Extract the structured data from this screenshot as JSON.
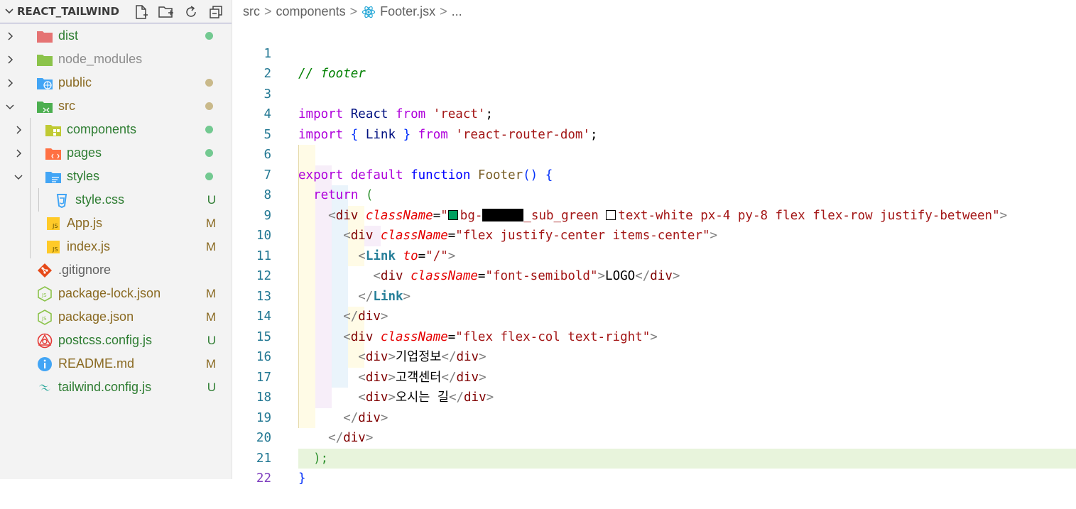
{
  "explorer": {
    "title": "REACT_TAILWIND",
    "actions": [
      "new-file-icon",
      "new-folder-icon",
      "refresh-icon",
      "collapse-all-icon"
    ],
    "items": [
      {
        "label": "dist",
        "type": "folder",
        "expanded": false,
        "depth": 0,
        "color": "#2e7d32",
        "status": "dot",
        "dot_color": "#73c991"
      },
      {
        "label": "node_modules",
        "type": "folder",
        "expanded": false,
        "depth": 0,
        "color": "#8c8c8c",
        "status": "",
        "dot_color": ""
      },
      {
        "label": "public",
        "type": "folder",
        "expanded": false,
        "depth": 0,
        "color": "#8a6a22",
        "status": "dot",
        "dot_color": "#c9b98a"
      },
      {
        "label": "src",
        "type": "folder",
        "expanded": true,
        "depth": 0,
        "color": "#8a6a22",
        "status": "dot",
        "dot_color": "#c9b98a"
      },
      {
        "label": "components",
        "type": "folder",
        "expanded": false,
        "depth": 1,
        "color": "#2e7d32",
        "status": "dot",
        "dot_color": "#73c991"
      },
      {
        "label": "pages",
        "type": "folder",
        "expanded": false,
        "depth": 1,
        "color": "#2e7d32",
        "status": "dot",
        "dot_color": "#73c991"
      },
      {
        "label": "styles",
        "type": "folder",
        "expanded": true,
        "depth": 1,
        "color": "#2e7d32",
        "status": "dot",
        "dot_color": "#73c991"
      },
      {
        "label": "style.css",
        "type": "file",
        "depth": 2,
        "color": "#2e7d32",
        "status": "U"
      },
      {
        "label": "App.js",
        "type": "file",
        "depth": 1,
        "color": "#8a6a22",
        "status": "M"
      },
      {
        "label": "index.js",
        "type": "file",
        "depth": 1,
        "color": "#8a6a22",
        "status": "M"
      },
      {
        "label": ".gitignore",
        "type": "file",
        "depth": 0,
        "color": "#616161",
        "status": ""
      },
      {
        "label": "package-lock.json",
        "type": "file",
        "depth": 0,
        "color": "#8a6a22",
        "status": "M"
      },
      {
        "label": "package.json",
        "type": "file",
        "depth": 0,
        "color": "#8a6a22",
        "status": "M"
      },
      {
        "label": "postcss.config.js",
        "type": "file",
        "depth": 0,
        "color": "#2e7d32",
        "status": "U"
      },
      {
        "label": "README.md",
        "type": "file",
        "depth": 0,
        "color": "#8a6a22",
        "status": "M"
      },
      {
        "label": "tailwind.config.js",
        "type": "file",
        "depth": 0,
        "color": "#2e7d32",
        "status": "U"
      }
    ]
  },
  "breadcrumb": {
    "parts": [
      "src",
      "components",
      "Footer.jsx",
      "..."
    ],
    "separator": ">"
  },
  "editor": {
    "active_line": 22,
    "line_numbers": [
      "1",
      "2",
      "3",
      "4",
      "5",
      "6",
      "7",
      "8",
      "9",
      "10",
      "11",
      "12",
      "13",
      "14",
      "15",
      "16",
      "17",
      "18",
      "19",
      "20",
      "21",
      "22"
    ],
    "code": {
      "l1_comment": "// footer",
      "l3_import": "import",
      "l3_react": "React",
      "l3_from": "from",
      "l3_str": "'react'",
      "l3_semi": ";",
      "l4_import": "import",
      "l4_open": "{",
      "l4_link": "Link",
      "l4_close": "}",
      "l4_from": "from",
      "l4_str": "'react-router-dom'",
      "l4_semi": ";",
      "l6_export": "export",
      "l6_default": "default",
      "l6_function": "function",
      "l6_name": "Footer",
      "l6_parens": "()",
      "l6_brace": "{",
      "l7_return": "return",
      "l7_paren": "(",
      "l8_tag": "div",
      "l8_attr": "className",
      "l8_val_a": "bg-",
      "l8_val_b": "_sub_green ",
      "l8_val_c": "text-white px-4 py-8 flex flex-row justify-between",
      "l9_tag": "div",
      "l9_attr": "className",
      "l9_val": "\"flex justify-center items-center\"",
      "l10_tag": "Link",
      "l10_attr": "to",
      "l10_val": "\"/\"",
      "l11_tag": "div",
      "l11_attr": "className",
      "l11_val": "\"font-semibold\"",
      "l11_text": "LOGO",
      "l11_close": "div",
      "l12_tag": "Link",
      "l13_tag": "div",
      "l14_tag": "div",
      "l14_attr": "className",
      "l14_val": "\"flex flex-col text-right\"",
      "l15_tag": "div",
      "l15_text": "기업정보",
      "l15_close": "div",
      "l16_tag": "div",
      "l16_text": "고객센터",
      "l16_close": "div",
      "l17_tag": "div",
      "l17_text": "오시는 길",
      "l17_close": "div",
      "l18_tag": "div",
      "l19_tag": "div",
      "l20_text": ");",
      "l21_text": "}"
    },
    "swatch_colors": {
      "green": "#00a060",
      "white": "#ffffff"
    }
  }
}
